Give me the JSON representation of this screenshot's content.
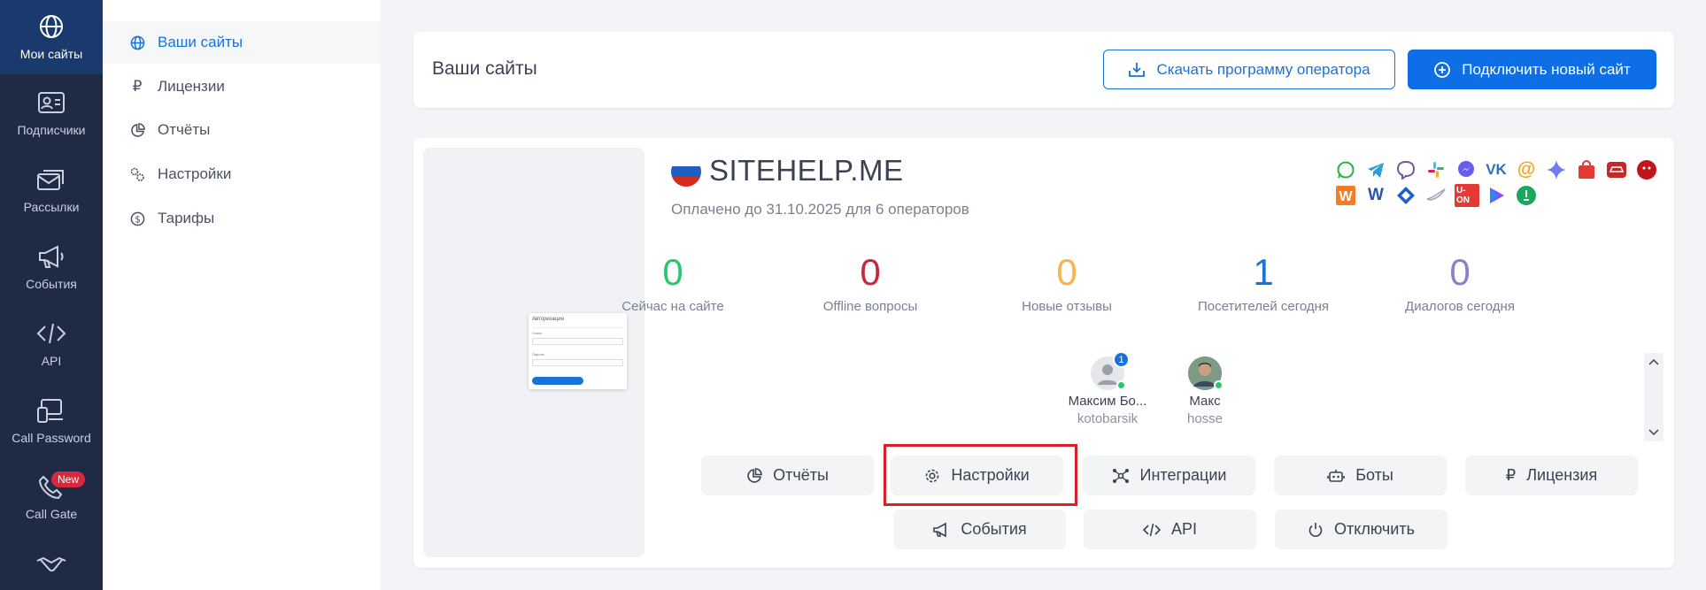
{
  "rail": {
    "items": [
      {
        "label": "Мои сайты"
      },
      {
        "label": "Подписчики"
      },
      {
        "label": "Рассылки"
      },
      {
        "label": "События"
      },
      {
        "label": "API"
      },
      {
        "label": "Call Password"
      },
      {
        "label": "Call Gate"
      }
    ],
    "new_badge": "New"
  },
  "submenu": {
    "items": [
      {
        "label": "Ваши сайты"
      },
      {
        "label": "Лицензии"
      },
      {
        "label": "Отчёты"
      },
      {
        "label": "Настройки"
      },
      {
        "label": "Тарифы"
      }
    ]
  },
  "header": {
    "title": "Ваши сайты",
    "download_label": "Скачать программу оператора",
    "connect_label": "Подключить новый сайт"
  },
  "site": {
    "name": "SITEHELP.ME",
    "paid_text": "Оплачено до 31.10.2025 для 6 операторов",
    "preview": {
      "title": "Авторизация",
      "login_label": "Логин",
      "password_label": "Пароль"
    },
    "stats": [
      {
        "value": "0",
        "label": "Сейчас на сайте",
        "color": "#28c76f"
      },
      {
        "value": "0",
        "label": "Offline вопросы",
        "color": "#c8283f"
      },
      {
        "value": "0",
        "label": "Новые отзывы",
        "color": "#f5b352"
      },
      {
        "value": "1",
        "label": "Посетителей сегодня",
        "color": "#1873d8"
      },
      {
        "value": "0",
        "label": "Диалогов сегодня",
        "color": "#8c7fd1"
      }
    ],
    "operators": [
      {
        "name": "Максим Бо...",
        "login": "kotobarsik",
        "unread": "1"
      },
      {
        "name": "Макс",
        "login": "hosse"
      }
    ],
    "actions": {
      "reports": "Отчёты",
      "settings": "Настройки",
      "integrations": "Интеграции",
      "bots": "Боты",
      "license": "Лицензия",
      "events": "События",
      "api": "API",
      "disable": "Отключить"
    },
    "channel_icons": {
      "row1": [
        "whatsapp-icon",
        "telegram-icon",
        "viber-icon",
        "slack-icon",
        "messenger-icon",
        "vk-icon",
        "email-icon",
        "diamond-icon",
        "bag-icon",
        "car-icon",
        "bear-icon"
      ],
      "row2": [
        "w-orange-icon",
        "w-blue-icon",
        "jira-icon",
        "bird-icon",
        "uon-icon",
        "play-icon",
        "pin-icon"
      ],
      "uon_text": "U-ON"
    }
  },
  "colors": {
    "accent": "#1873d8",
    "rail_bg": "#1f2a44",
    "highlight": "#d8202a"
  }
}
